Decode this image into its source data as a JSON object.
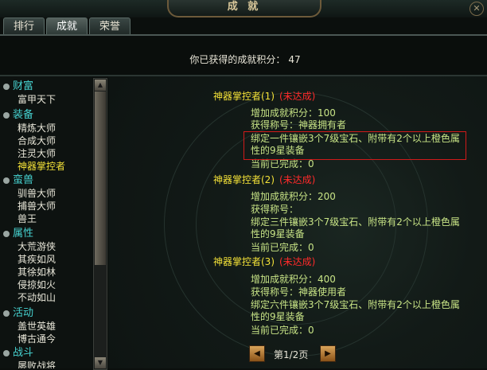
{
  "window": {
    "title": "成 就"
  },
  "tabs": [
    {
      "label": "排行",
      "active": false
    },
    {
      "label": "成就",
      "active": true
    },
    {
      "label": "荣誉",
      "active": false
    }
  ],
  "score": {
    "label": "你已获得的成就积分：",
    "value": "47"
  },
  "sidebar": {
    "categories": [
      {
        "label": "财富",
        "items": [
          "富甲天下"
        ]
      },
      {
        "label": "装备",
        "items": [
          "精炼大师",
          "合成大师",
          "注灵大师",
          "神器掌控者"
        ]
      },
      {
        "label": "蛮兽",
        "items": [
          "驯兽大师",
          "捕兽大师",
          "兽王"
        ]
      },
      {
        "label": "属性",
        "items": [
          "大荒游侠",
          "其疾如风",
          "其徐如林",
          "侵掠如火",
          "不动如山"
        ]
      },
      {
        "label": "活动",
        "items": [
          "盖世英雄",
          "博古通今"
        ]
      },
      {
        "label": "战斗",
        "items": [
          "屡败战将"
        ]
      }
    ],
    "selected_item": "神器掌控者"
  },
  "achievements": [
    {
      "title": "神器掌控者(1)",
      "status": "(未达成)",
      "points": "增加成就积分：100",
      "reward_title": "获得称号：神器拥有者",
      "description_1": "绑定一件镶嵌3个7级宝石、附带有2个以上橙色属",
      "description_2": "性的9星装备",
      "progress": "当前已完成：0"
    },
    {
      "title": "神器掌控者(2)",
      "status": "(未达成)",
      "points": "增加成就积分：200",
      "reward_title": "获得称号：",
      "description_1": "绑定三件镶嵌3个7级宝石、附带有2个以上橙色属",
      "description_2": "性的9星装备",
      "progress": "当前已完成：0"
    },
    {
      "title": "神器掌控者(3)",
      "status": "(未达成)",
      "points": "增加成就积分：400",
      "reward_title": "获得称号：神器使用者",
      "description_1": "绑定六件镶嵌3个7级宝石、附带有2个以上橙色属",
      "description_2": "性的9星装备",
      "progress": "当前已完成：0"
    }
  ],
  "pager": {
    "label": "第1/2页"
  },
  "colors": {
    "category": "#46d1cf",
    "selected": "#f4e238",
    "status": "#ff2a2a",
    "detail": "#c8e486"
  }
}
